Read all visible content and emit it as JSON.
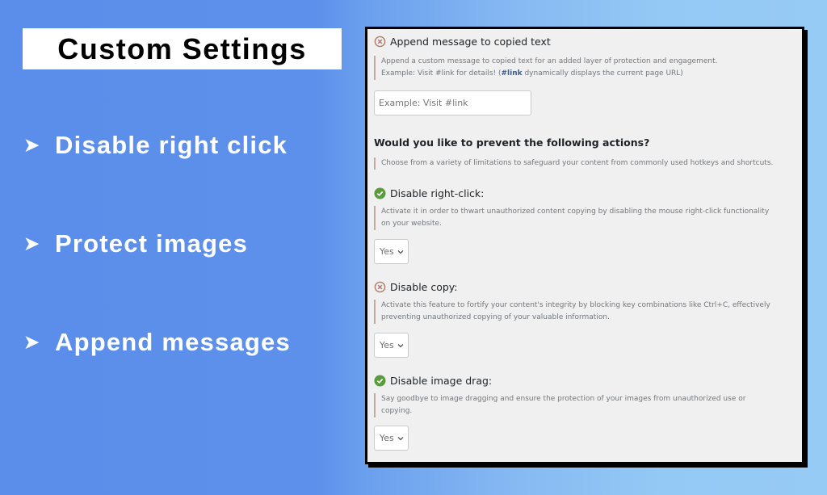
{
  "title": "Custom Settings",
  "features": [
    {
      "bullet": "➤",
      "label": "Disable right click"
    },
    {
      "bullet": "➤",
      "label": "Protect images"
    },
    {
      "bullet": "➤",
      "label": "Append messages"
    }
  ],
  "panel": {
    "append": {
      "status_icon": "x-circle-icon",
      "heading": "Append message to copied text",
      "desc_line1": "Append a custom message to copied text for an added layer of protection and engagement.",
      "desc_line2_pre": "Example: Visit #link for details! (",
      "desc_line2_bold": "#link",
      "desc_line2_post": " dynamically displays the current page URL)",
      "input_placeholder": "Example: Visit #link",
      "input_value": ""
    },
    "question": {
      "heading": "Would you like to prevent the following actions?",
      "desc": "Choose from a variety of limitations to safeguard your content from commonly used hotkeys and shortcuts."
    },
    "options": [
      {
        "status_icon": "check-circle-icon",
        "heading": "Disable right-click:",
        "desc": "Activate it in order to thwart unauthorized content copying by disabling the mouse right-click functionality on your website.",
        "value": "Yes"
      },
      {
        "status_icon": "x-circle-icon",
        "heading": "Disable copy:",
        "desc": "Activate this feature to fortify your content's integrity by blocking key combinations like Ctrl+C, effectively preventing unauthorized copying of your valuable information.",
        "value": "Yes"
      },
      {
        "status_icon": "check-circle-icon",
        "heading": "Disable image drag:",
        "desc": "Say goodbye to image dragging and ensure the protection of your images from unauthorized use or copying.",
        "value": "Yes"
      }
    ]
  },
  "colors": {
    "check_green": "#5b9a3e",
    "x_brown": "#b07a66",
    "panel_bg": "#f0f0f1"
  }
}
